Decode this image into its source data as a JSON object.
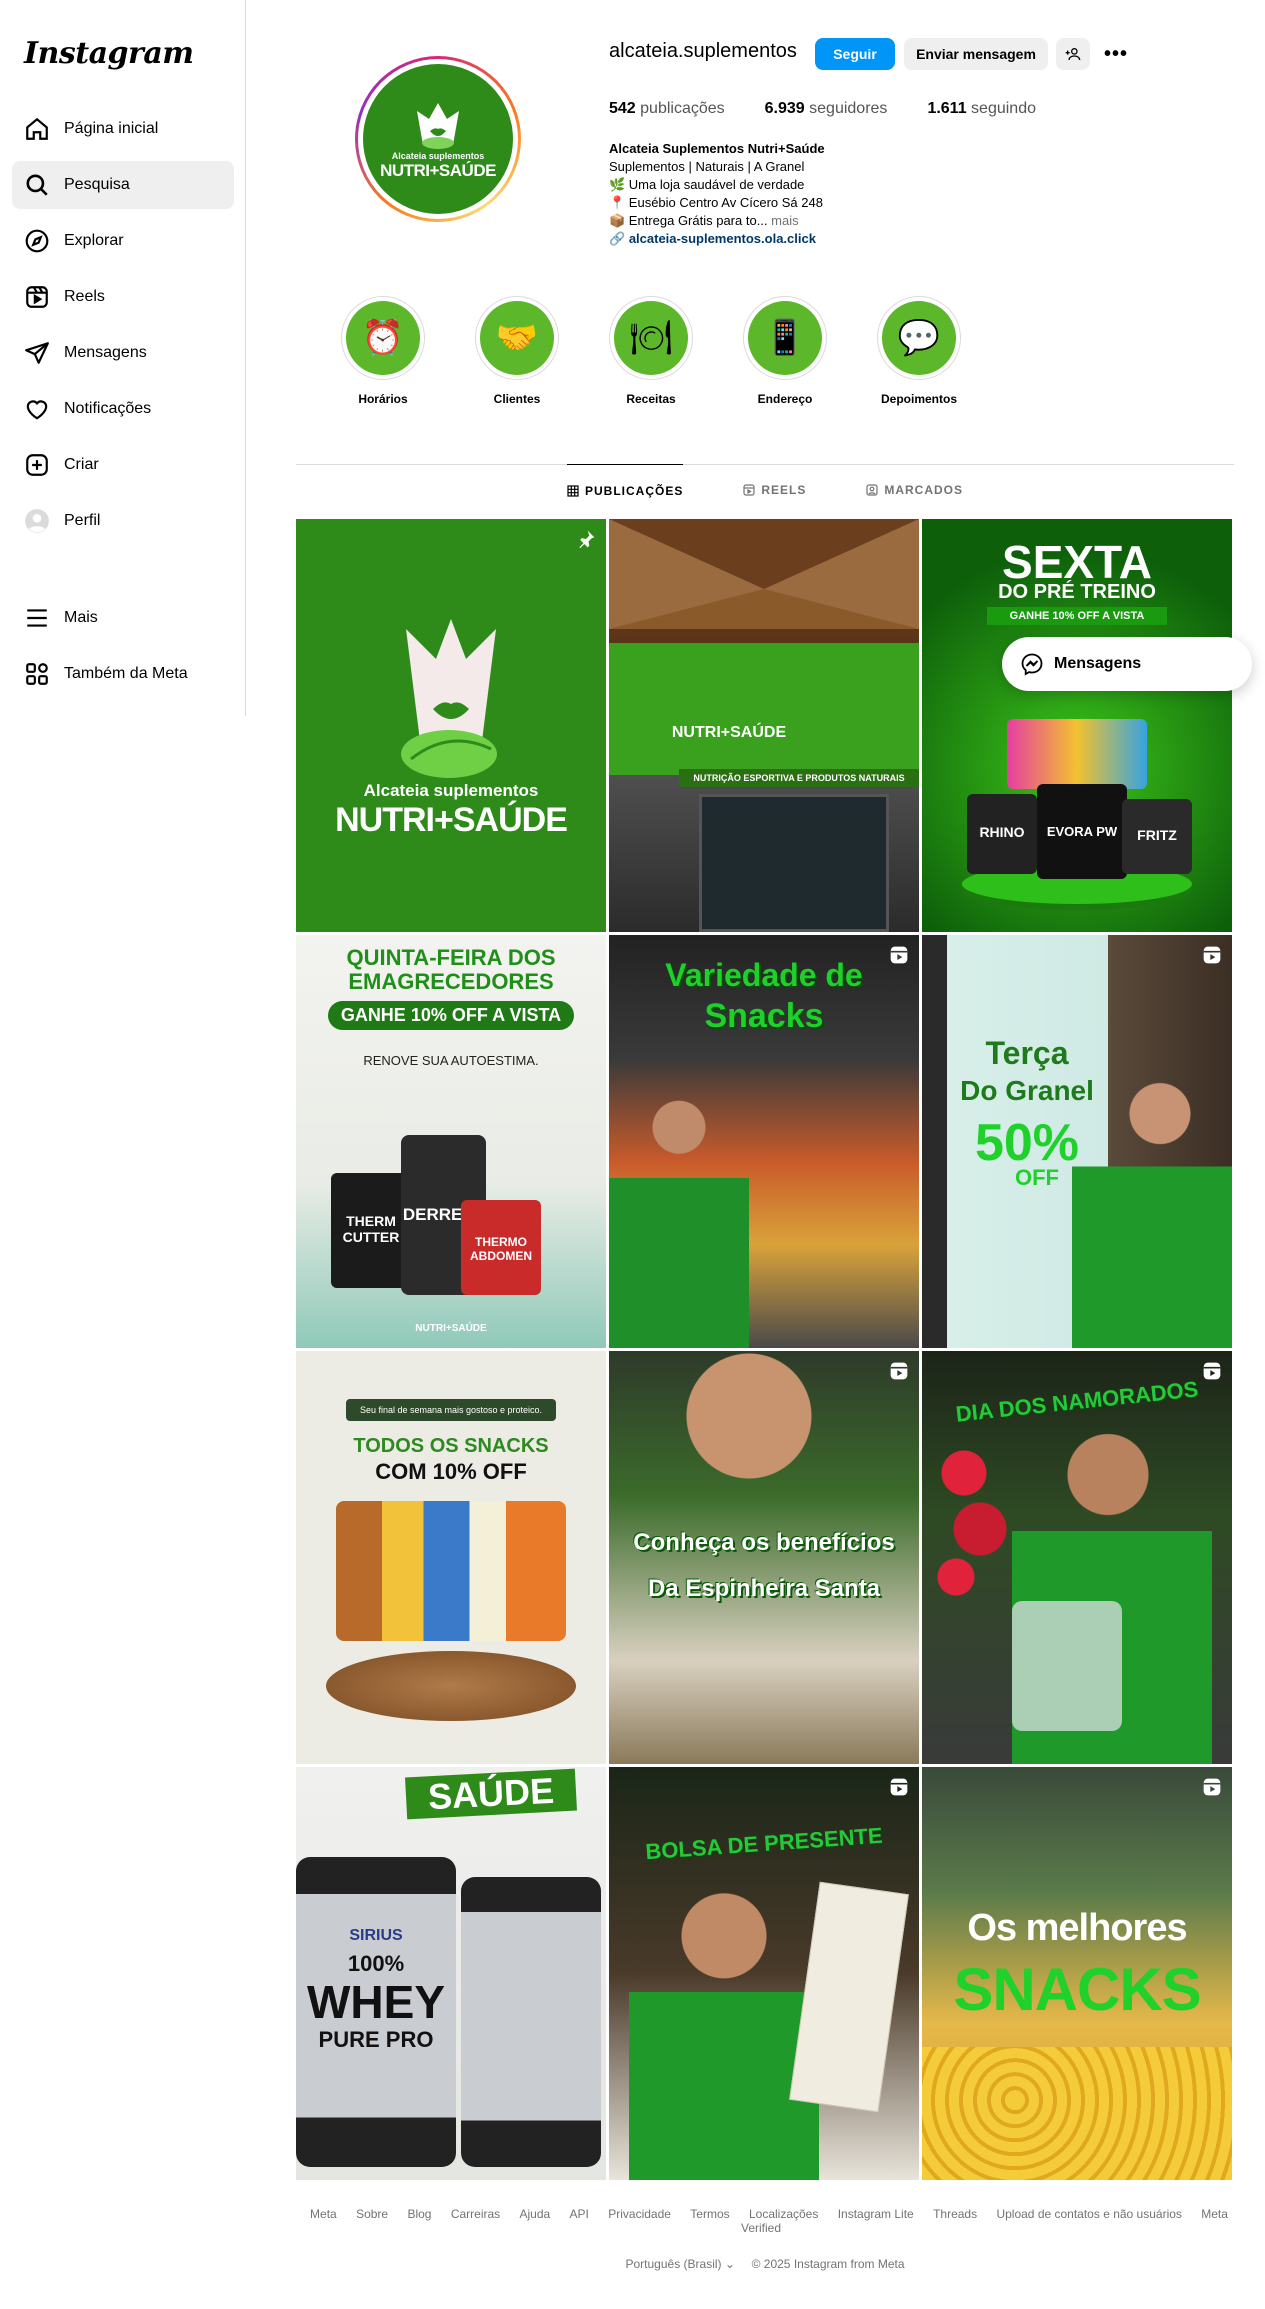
{
  "sidebar": {
    "logo": "Instagram",
    "items": [
      {
        "label": "Página inicial",
        "icon": "home-icon"
      },
      {
        "label": "Pesquisa",
        "icon": "search-icon"
      },
      {
        "label": "Explorar",
        "icon": "compass-icon"
      },
      {
        "label": "Reels",
        "icon": "reels-icon"
      },
      {
        "label": "Mensagens",
        "icon": "direct-icon"
      },
      {
        "label": "Notificações",
        "icon": "heart-icon"
      },
      {
        "label": "Criar",
        "icon": "plus-square-icon"
      },
      {
        "label": "Perfil",
        "icon": "avatar-icon"
      }
    ],
    "bottom": [
      {
        "label": "Mais",
        "icon": "menu-icon"
      },
      {
        "label": "Também da Meta",
        "icon": "meta-icon"
      }
    ]
  },
  "profile": {
    "username": "alcateia.suplementos",
    "follow_label": "Seguir",
    "message_label": "Enviar mensagem",
    "more_label": "•••",
    "avatar": {
      "line1": "Alcateia suplementos",
      "line2": "NUTRI+SAÚDE"
    },
    "stats": {
      "posts": "542",
      "posts_label": "publicações",
      "followers": "6.939",
      "followers_label": "seguidores",
      "following": "1.611",
      "following_label": "seguindo"
    },
    "bio": {
      "name": "Alcateia Suplementos Nutri+Saúde",
      "category": "Suplementos | Naturais | A Granel",
      "line1": "🌿 Uma loja saudável de verdade",
      "line2": "📍 Eusébio Centro Av Cícero Sá 248",
      "line3": "📦 Entrega Grátis para to...",
      "more": "mais",
      "link": "alcateia-suplementos.ola.click"
    }
  },
  "highlights": [
    {
      "label": "Horários",
      "emoji": "⏰"
    },
    {
      "label": "Clientes",
      "emoji": "🤝"
    },
    {
      "label": "Receitas",
      "emoji": "🍽"
    },
    {
      "label": "Endereço",
      "emoji": "📱"
    },
    {
      "label": "Depoimentos",
      "emoji": "💬"
    }
  ],
  "tabs": [
    "PUBLICAÇÕES",
    "REELS",
    "MARCADOS"
  ],
  "posts": {
    "p1": {
      "line1": "Alcateia suplementos",
      "line2": "NUTRI+SAÚDE"
    },
    "p2": {
      "sign1": "NUTRI+SAÚDE",
      "sign2": "NUTRIÇÃO ESPORTIVA E PRODUTOS NATURAIS"
    },
    "p3": {
      "line1": "SEXTA",
      "line2": "DO PRÉ TREINO",
      "line3": "GANHE 10% OFF A VISTA",
      "tub1": "RHINO",
      "tub2": "EVORA PW",
      "tub3": "FRITZ"
    },
    "p4": {
      "line1": "QUINTA-FEIRA DOS",
      "line2": "EMAGRECEDORES",
      "line3": "GANHE 10% OFF A VISTA",
      "line4": "RENOVE SUA AUTOESTIMA.",
      "tub1": "THERM CUTTER",
      "tub2": "DERRETE",
      "tub3": "THERMO ABDOMEN",
      "foot": "NUTRI+SAÚDE"
    },
    "p5": {
      "line1": "Variedade de",
      "line2": "Snacks"
    },
    "p6": {
      "line1": "Terça",
      "line2": "Do Granel",
      "line3": "50%",
      "line4": "OFF"
    },
    "p7": {
      "line1": "Seu final de semana mais gostoso e proteico.",
      "line2": "TODOS OS SNACKS",
      "line3": "COM 10% OFF"
    },
    "p8": {
      "line1": "Conheça os benefícios",
      "line2": "Da Espinheira Santa"
    },
    "p9": {
      "line1": "DIA DOS NAMORADOS"
    },
    "p10": {
      "line1": "SAÚDE",
      "brand": "SIRIUS",
      "line2": "100%",
      "line3": "WHEY",
      "line4": "PURE PRO"
    },
    "p11": {
      "line1": "BOLSA DE PRESENTE"
    },
    "p12": {
      "line1": "Os melhores",
      "line2": "SNACKS"
    }
  },
  "toast": {
    "label": "Mensagens"
  },
  "footer": {
    "links": [
      "Meta",
      "Sobre",
      "Blog",
      "Carreiras",
      "Ajuda",
      "API",
      "Privacidade",
      "Termos",
      "Localizações",
      "Instagram Lite",
      "Threads",
      "Upload de contatos e não usuários",
      "Meta Verified"
    ],
    "language": "Português (Brasil)",
    "copyright": "© 2025 Instagram from Meta"
  },
  "colors": {
    "accent": "#0095f6",
    "brand_green": "#2e8b1a",
    "highlight_green": "#5cb82a"
  }
}
